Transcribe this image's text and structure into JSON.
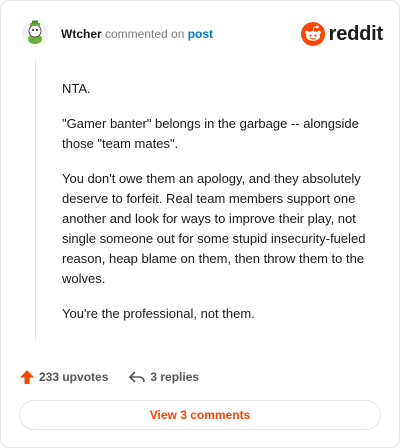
{
  "header": {
    "username": "Wtcher",
    "action_text": " commented on ",
    "target_link": "post",
    "brand_name": "reddit"
  },
  "comment": {
    "paragraphs": [
      "NTA.",
      "\"Gamer banter\" belongs in the garbage -- alongside those \"team mates\".",
      "You don't owe them an apology, and they absolutely deserve to forfeit. Real team members support one another and look for ways to improve their play, not single someone out for some stupid insecurity-fueled reason, heap blame on them, then throw them to the wolves.",
      "You're the professional, not them."
    ]
  },
  "actions": {
    "upvotes_label": "233 upvotes",
    "replies_label": "3 replies"
  },
  "footer": {
    "view_comments_label": "View 3 comments"
  },
  "colors": {
    "brand_orange": "#ff4500",
    "link_blue": "#0079d3"
  }
}
